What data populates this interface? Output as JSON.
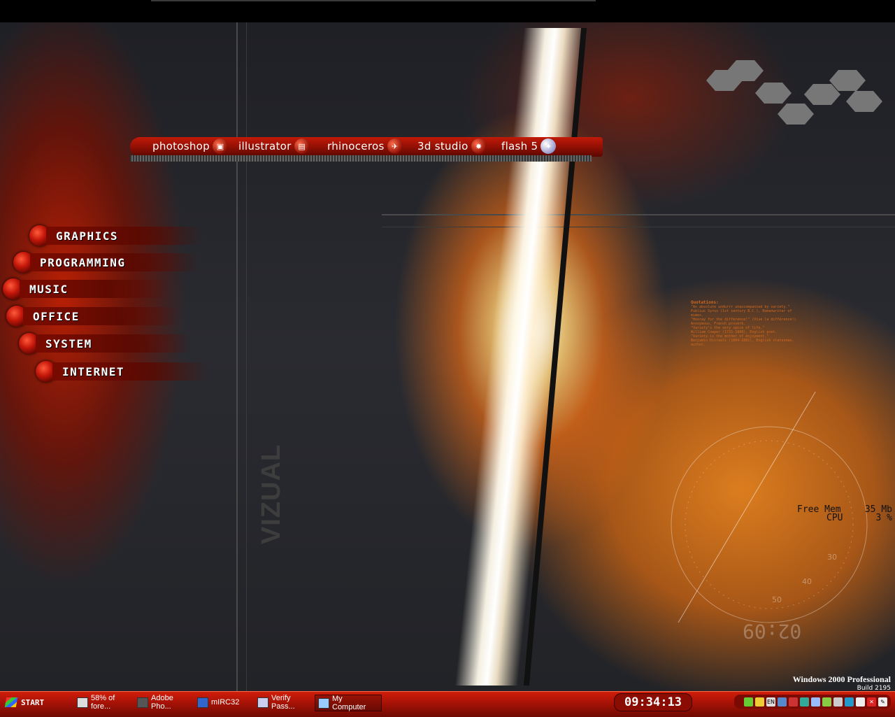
{
  "launcher": {
    "apps": [
      {
        "label": "photoshop",
        "icon": "photoshop-icon"
      },
      {
        "label": "illustrator",
        "icon": "illustrator-icon"
      },
      {
        "label": "rhinoceros",
        "icon": "rhinoceros-icon"
      },
      {
        "label": "3d studio",
        "icon": "3d-studio-icon"
      },
      {
        "label": "flash 5",
        "icon": "flash-icon"
      }
    ]
  },
  "menu": {
    "categories": [
      "GRAPHICS",
      "PROGRAMMING",
      "MUSIC",
      "OFFICE",
      "SYSTEM",
      "INTERNET"
    ]
  },
  "sysinfo": {
    "free_mem_label": "Free Mem",
    "free_mem_value": "35 Mb",
    "cpu_label": "CPU",
    "cpu_value": "3 %"
  },
  "wallpaper": {
    "vizual_text": "VIZUAL",
    "quotes_title": "Quotations:",
    "quotes_lines": [
      "\"An absolute undurrr unaccompanied by variety.\"",
      "Publius Syrus (1st century B.C.), Romanwriter of mimes.",
      "\"Hooray for the difference!\" (Vive la différence!)",
      "Anonymous, French proverb.",
      "\"Variety's the very spice of life.\"",
      "William Cowper (1731-1800), English poet.",
      "\"Variety is the mother of enjoyment.\"",
      "Benjamin Disraeli (1804-1881), English statesman, author."
    ],
    "dial_time": "02:09",
    "dial_numbers": [
      "30",
      "40",
      "50"
    ]
  },
  "os": {
    "title": "Windows 2000 Professional",
    "build": "Build 2195"
  },
  "taskbar": {
    "start_label": "START",
    "tasks": [
      {
        "label": "58% of fore...",
        "icon": "download-window-icon"
      },
      {
        "label": "Adobe Pho...",
        "icon": "photoshop-task-icon"
      },
      {
        "label": "mIRC32",
        "icon": "mirc-icon"
      },
      {
        "label": "Verify Pass...",
        "icon": "key-icon"
      },
      {
        "label": "My Computer",
        "icon": "my-computer-icon"
      }
    ],
    "clock": "09:34:13",
    "tray_lang": "EN"
  }
}
